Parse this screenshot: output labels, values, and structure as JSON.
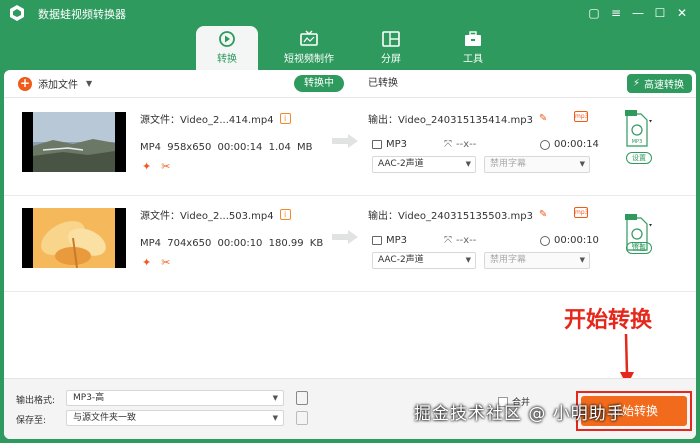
{
  "app": {
    "title": "数据蛙视频转换器"
  },
  "nav": {
    "tabs": [
      {
        "label": "转换",
        "active": true,
        "icon": "convert-icon"
      },
      {
        "label": "短视频制作",
        "icon": "tv-icon"
      },
      {
        "label": "分屏",
        "icon": "split-screen-icon"
      },
      {
        "label": "工具",
        "icon": "toolbox-icon"
      }
    ]
  },
  "toolbar": {
    "add_files": "添加文件",
    "tab_converting": "转换中",
    "tab_converted": "已转换",
    "fast_convert": "高速转换"
  },
  "rows": [
    {
      "source": "源文件：Video_2...414.mp4",
      "format": "MP4",
      "resolution": "958x650",
      "duration": "00:00:14",
      "size": "1.04 MB",
      "output": "输出：Video_240315135414.mp3",
      "out_format": "MP3",
      "out_resolution": "--x--",
      "out_duration": "00:00:14",
      "audio": "AAC-2声道",
      "subtitle": "禁用字幕",
      "file_badge": "MP3",
      "settings": "设置"
    },
    {
      "source": "源文件：Video_2...503.mp4",
      "format": "MP4",
      "resolution": "704x650",
      "duration": "00:00:10",
      "size": "180.99 KB",
      "output": "输出：Video_240315135503.mp3",
      "out_format": "MP3",
      "out_resolution": "--x--",
      "out_duration": "00:00:10",
      "audio": "AAC-2声道",
      "subtitle": "禁用字幕",
      "file_badge": "MP3",
      "settings": "设置"
    }
  ],
  "annotation": "开始转换",
  "bottom": {
    "output_format_label": "输出格式:",
    "output_format_value": "MP3-高",
    "save_to_label": "保存至:",
    "save_to_value": "与源文件夹一致",
    "merge_label": "合并",
    "start_button": "开始转换"
  },
  "watermark": "掘金技术社区 @ 小明助手",
  "colors": {
    "brand": "#2e9a5e",
    "accent": "#f26b1d",
    "annotation": "#e5281b"
  }
}
